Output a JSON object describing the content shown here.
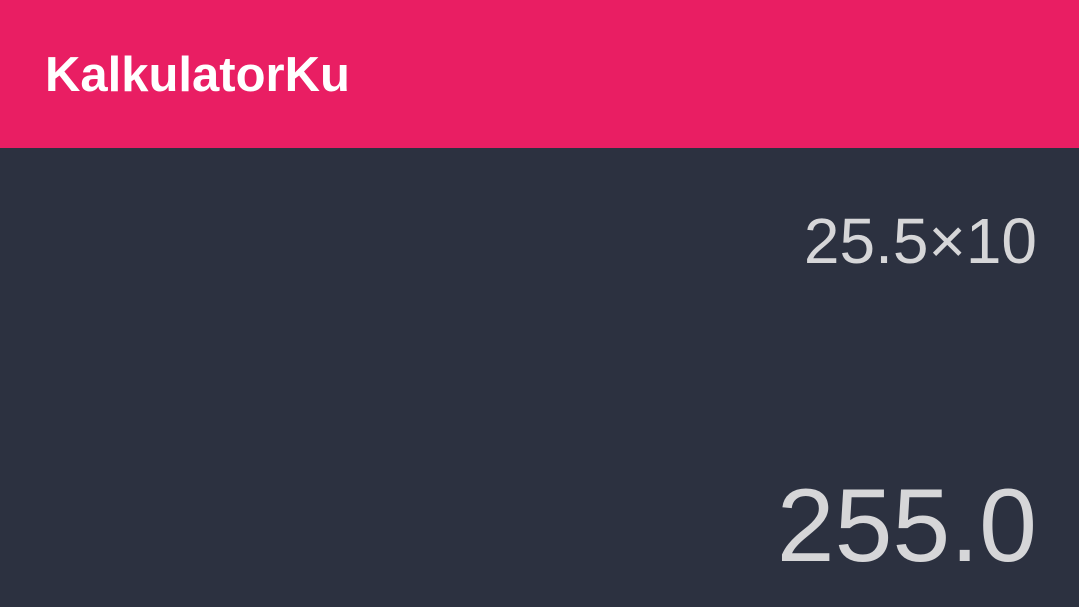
{
  "app_bar": {
    "title": "KalkulatorKu",
    "color": "#e91e63"
  },
  "display": {
    "expression": "25.5×10",
    "result": "255.0",
    "background": "#2c3140",
    "text_color": "#d6d6d8"
  }
}
